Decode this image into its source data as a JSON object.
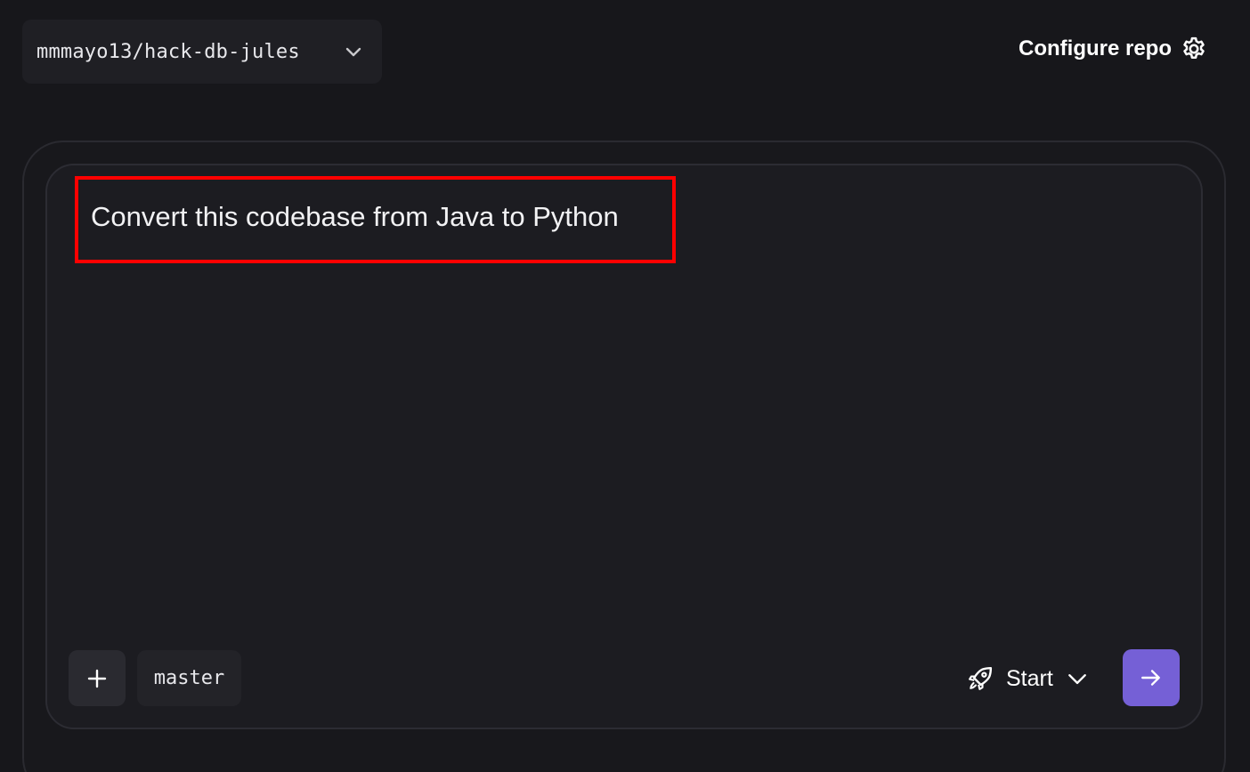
{
  "header": {
    "repo_name": "mmmayo13/hack-db-jules",
    "configure_label": "Configure repo"
  },
  "prompt": {
    "text": "Convert this codebase from Java to Python",
    "highlight_color": "#ff0000"
  },
  "toolbar": {
    "branch": "master",
    "start_label": "Start",
    "accent_color": "#7560d6"
  },
  "icons": {
    "repo_dropdown": "chevron-down-icon",
    "configure": "gear-icon",
    "add": "plus-icon",
    "start": "rocket-icon",
    "start_dropdown": "chevron-down-icon",
    "submit": "arrow-right-icon"
  }
}
